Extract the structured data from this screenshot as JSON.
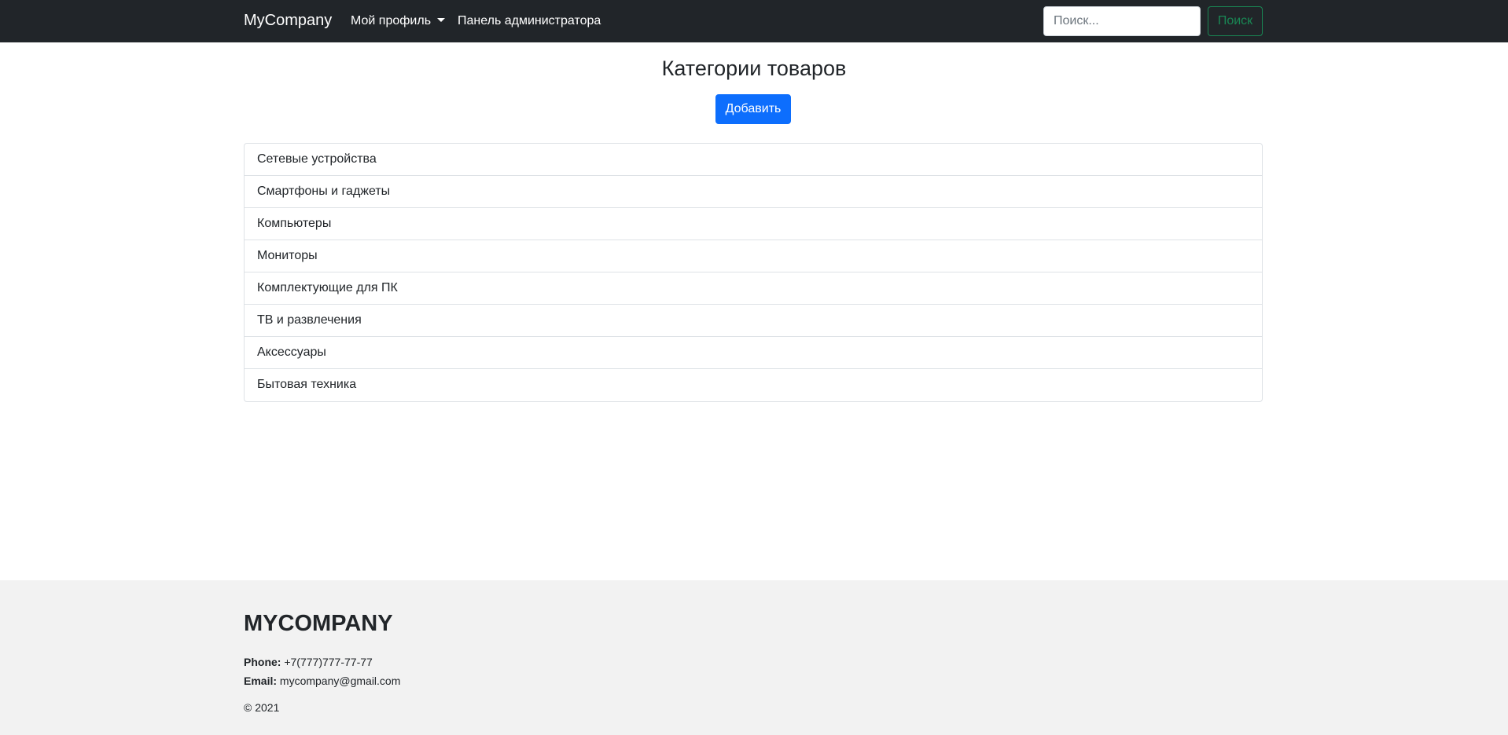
{
  "navbar": {
    "brand": "MyCompany",
    "profile_label": "Мой профиль",
    "admin_label": "Панель администратора",
    "search_placeholder": "Поиск...",
    "search_button": "Поиск"
  },
  "main": {
    "title": "Категории товаров",
    "add_button": "Добавить",
    "categories": [
      "Сетевые устройства",
      "Смартфоны и гаджеты",
      "Компьютеры",
      "Мониторы",
      "Комплектующие для ПК",
      "ТВ и развлечения",
      "Аксессуары",
      "Бытовая техника"
    ]
  },
  "footer": {
    "brand": "MYCOMPANY",
    "phone_label": "Phone:",
    "phone_value": "+7(777)777-77-77",
    "email_label": "Email:",
    "email_value": "mycompany@gmail.com",
    "copyright": "© 2021"
  },
  "colors": {
    "navbar_bg": "#212529",
    "primary": "#0d6efd",
    "success": "#198754",
    "footer_bg": "#f2f2f2"
  }
}
